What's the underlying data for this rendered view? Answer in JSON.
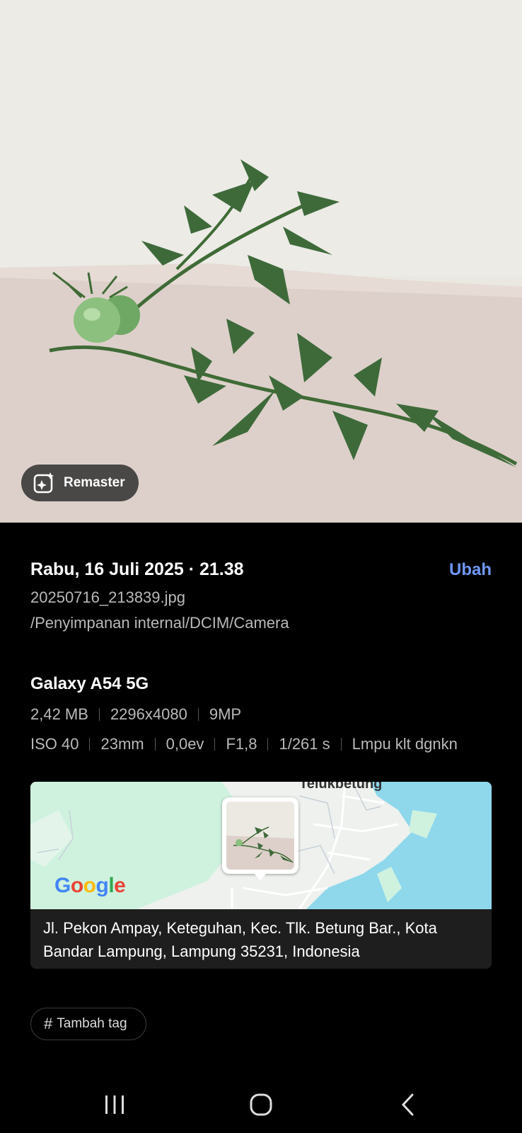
{
  "photo": {
    "remaster_label": "Remaster"
  },
  "details": {
    "date": "Rabu, 16 Juli 2025 · 21.38",
    "edit_label": "Ubah",
    "filename": "20250716_213839.jpg",
    "path": "/Penyimpanan internal/DCIM/Camera"
  },
  "device": {
    "name": "Galaxy A54 5G",
    "file_size": "2,42 MB",
    "resolution": "2296x4080",
    "megapixels": "9MP",
    "iso": "ISO 40",
    "focal_length": "23mm",
    "exposure": "0,0ev",
    "aperture": "F1,8",
    "shutter": "1/261 s",
    "flash": "Lmpu klt dgnkn"
  },
  "map": {
    "place_label": "Telukbetung",
    "provider": "Google",
    "address": "Jl. Pekon Ampay, Keteguhan, Kec. Tlk. Betung Bar., Kota Bandar Lampung, Lampung 35231, Indonesia"
  },
  "tags": {
    "add_label": "Tambah tag"
  },
  "colors": {
    "accent": "#6f97f6",
    "background": "#000000",
    "secondary_text": "#b9b9b9",
    "water": "#8fd8ec",
    "land_green": "#cff2df"
  },
  "icons": {
    "remaster": "sparkle-photo-icon",
    "tag": "hash-icon",
    "nav_recents": "recents-icon",
    "nav_home": "home-icon",
    "nav_back": "back-icon"
  }
}
